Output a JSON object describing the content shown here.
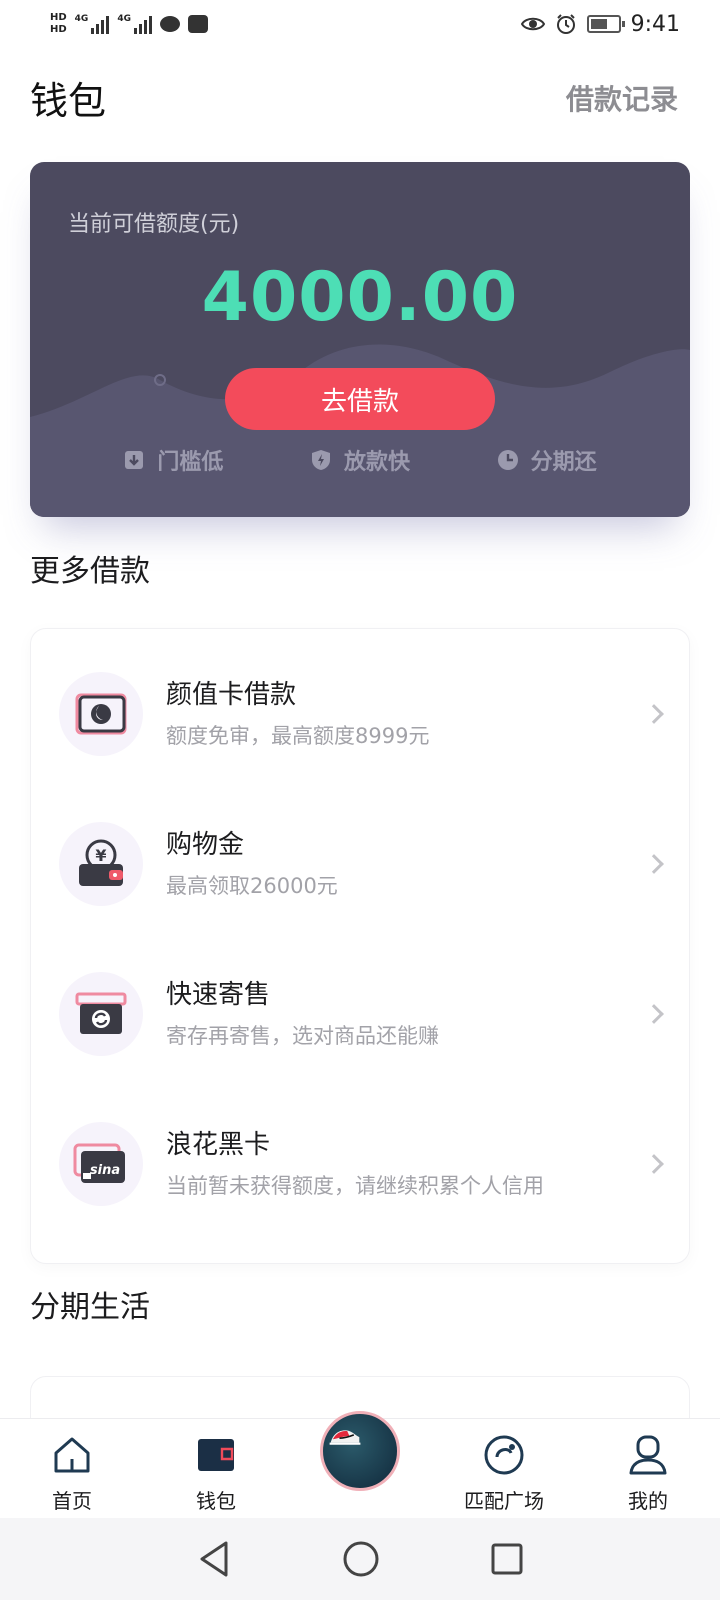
{
  "status_bar": {
    "network_left": "HD",
    "network_label": "4G",
    "time": "9:41"
  },
  "header": {
    "title": "钱包",
    "record_link": "借款记录"
  },
  "credit_card": {
    "label": "当前可借额度(元)",
    "amount": "4000.00",
    "button": "去借款",
    "features": [
      {
        "icon": "download-icon",
        "label": "门槛低"
      },
      {
        "icon": "shield-bolt-icon",
        "label": "放款快"
      },
      {
        "icon": "clock-icon",
        "label": "分期还"
      }
    ],
    "colors": {
      "background": "#4c4a5f",
      "amount": "#4ddeb5",
      "button": "#f34b5b"
    }
  },
  "more_loans": {
    "title": "更多借款",
    "items": [
      {
        "icon": "beauty-card-icon",
        "title": "颜值卡借款",
        "subtitle": "额度免审，最高额度8999元"
      },
      {
        "icon": "wallet-yen-icon",
        "title": "购物金",
        "subtitle": "最高领取26000元"
      },
      {
        "icon": "consignment-box-icon",
        "title": "快速寄售",
        "subtitle": "寄存再寄售，选对商品还能赚"
      },
      {
        "icon": "sina-card-icon",
        "title": "浪花黑卡",
        "subtitle": "当前暂未获得额度，请继续积累个人信用"
      }
    ]
  },
  "installment_life": {
    "title": "分期生活"
  },
  "tab_bar": {
    "tabs": [
      {
        "icon": "home-icon",
        "label": "首页"
      },
      {
        "icon": "wallet-icon",
        "label": "钱包"
      },
      {
        "icon": "sneaker-icon",
        "label": ""
      },
      {
        "icon": "match-icon",
        "label": "匹配广场"
      },
      {
        "icon": "profile-icon",
        "label": "我的"
      }
    ]
  },
  "nav_bar": {
    "buttons": [
      "back-icon",
      "home-circle-icon",
      "recents-icon"
    ]
  }
}
